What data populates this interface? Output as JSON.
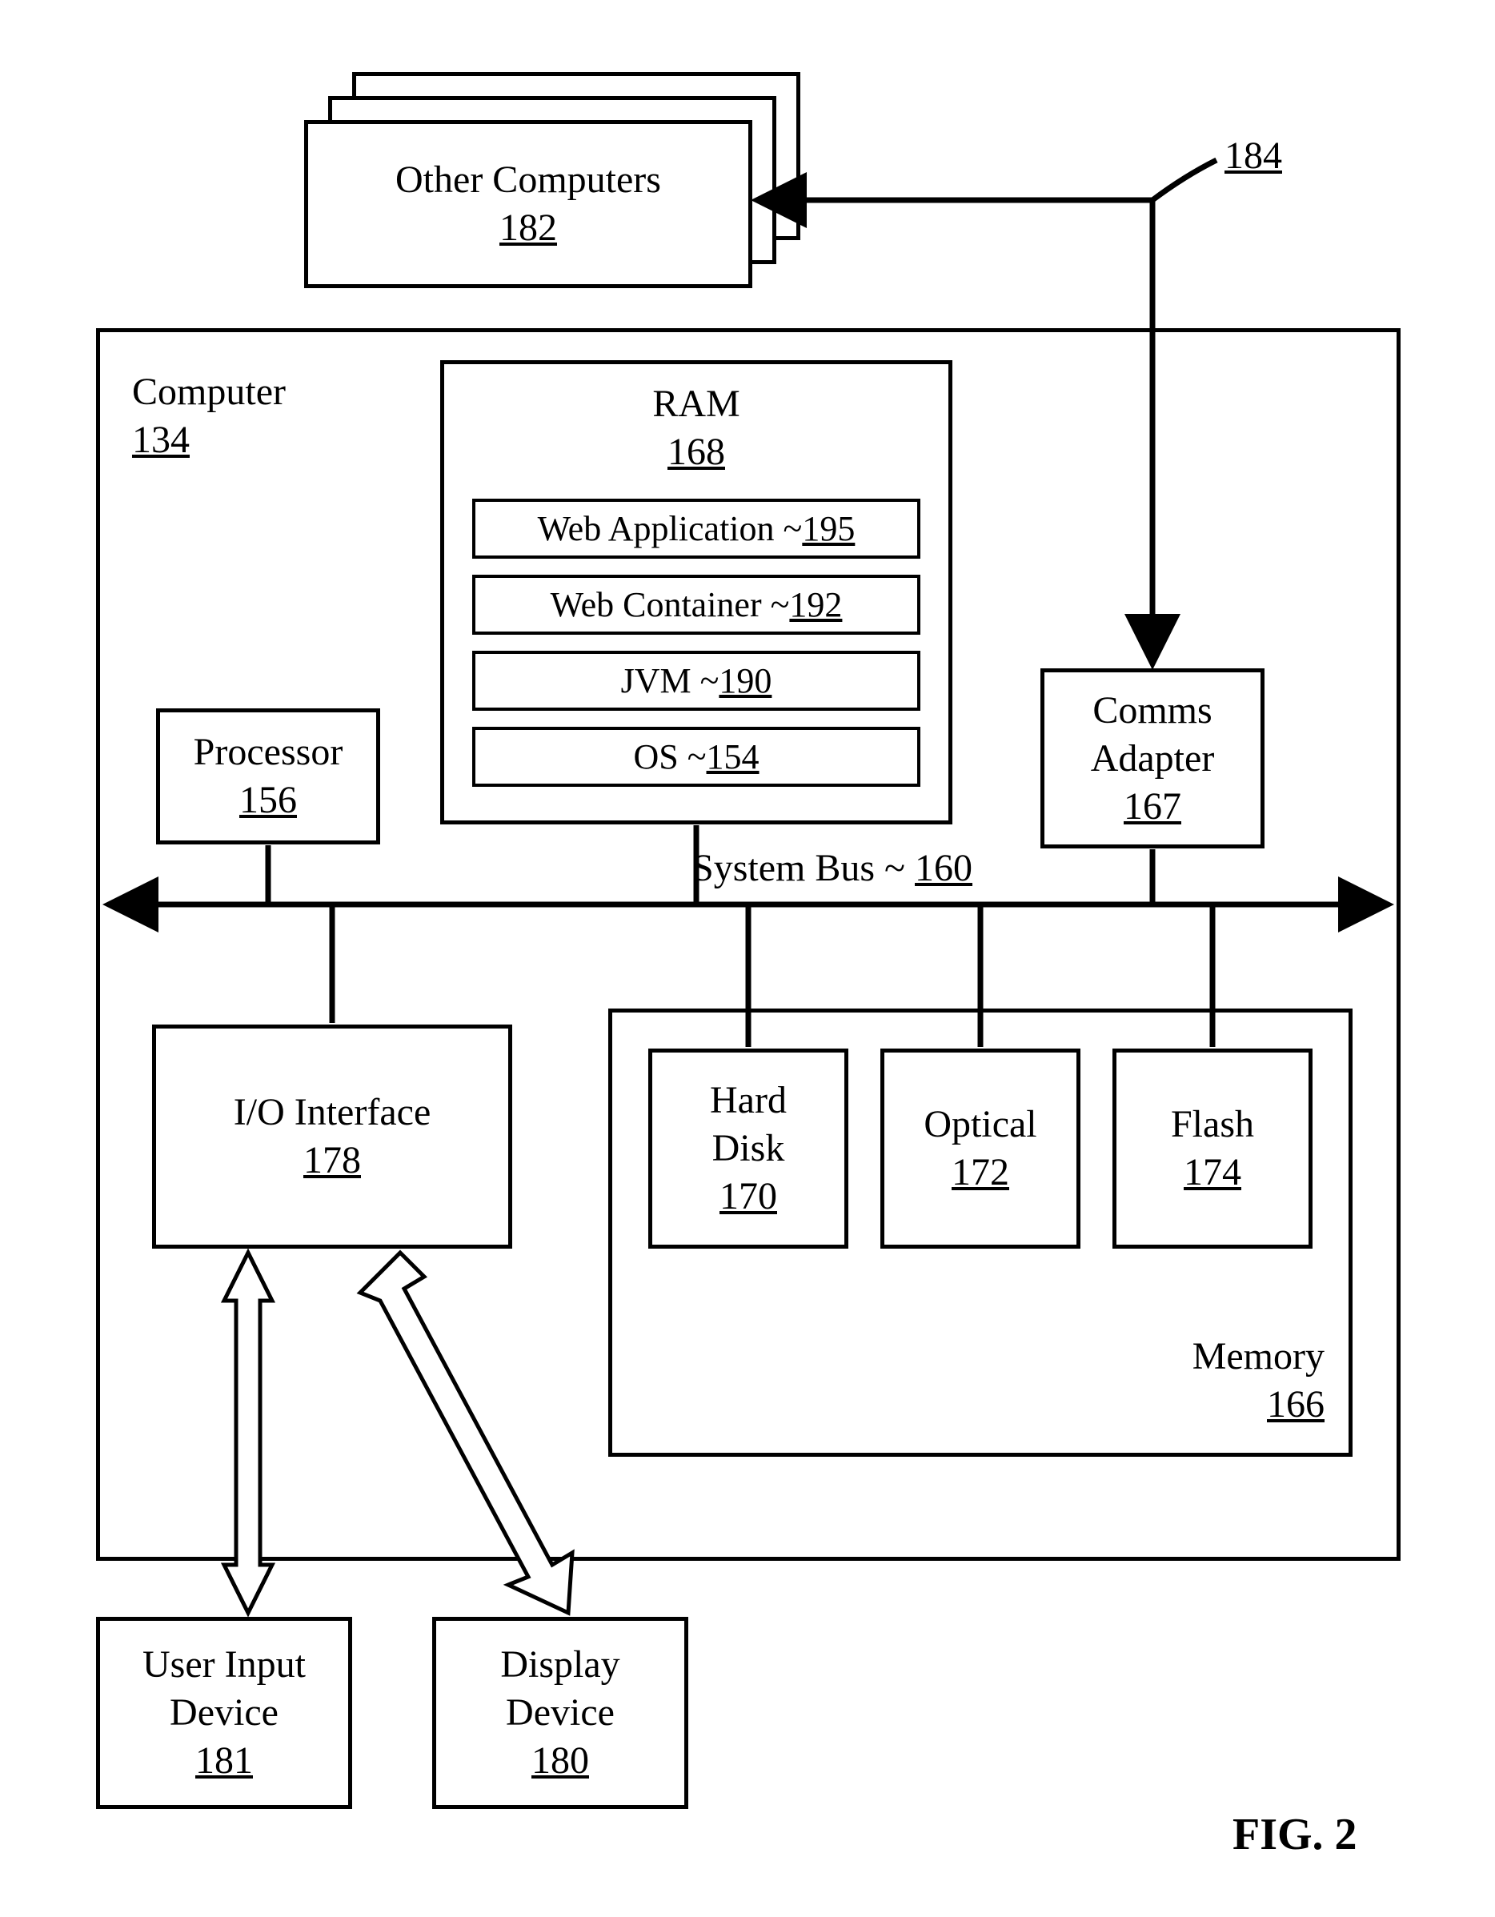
{
  "other_computers": {
    "title": "Other Computers",
    "ref": "182"
  },
  "net_ref": "184",
  "computer": {
    "title": "Computer",
    "ref": "134"
  },
  "ram": {
    "title": "RAM",
    "ref": "168",
    "rows": {
      "web_app": {
        "label": "Web Application ~ ",
        "ref": "195"
      },
      "web_cont": {
        "label": "Web Container ~ ",
        "ref": "192"
      },
      "jvm": {
        "label": "JVM ~ ",
        "ref": "190"
      },
      "os": {
        "label": "OS ~ ",
        "ref": "154"
      }
    }
  },
  "processor": {
    "title": "Processor",
    "ref": "156"
  },
  "comms": {
    "title": "Comms\nAdapter",
    "ref": "167"
  },
  "system_bus_label": "System Bus ~ ",
  "system_bus_ref": "160",
  "io": {
    "title": "I/O Interface",
    "ref": "178"
  },
  "hard_disk": {
    "title": "Hard\nDisk",
    "ref": "170"
  },
  "optical": {
    "title": "Optical",
    "ref": "172"
  },
  "flash": {
    "title": "Flash",
    "ref": "174"
  },
  "memory": {
    "title": "Memory",
    "ref": "166"
  },
  "user_input": {
    "title": "User Input\nDevice",
    "ref": "181"
  },
  "display": {
    "title": "Display\nDevice",
    "ref": "180"
  },
  "figure": "FIG. 2"
}
